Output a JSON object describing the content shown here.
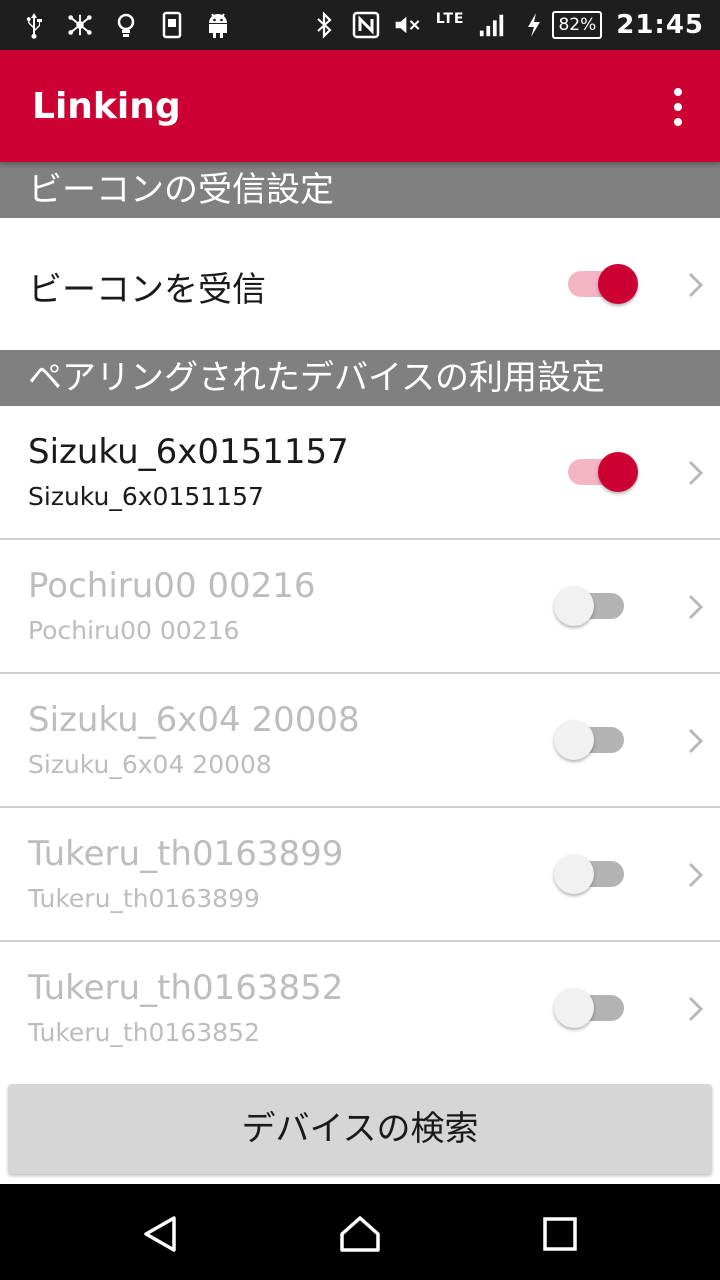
{
  "status_bar": {
    "left_icons": [
      "usb-icon",
      "network-sharing-icon",
      "lightbulb-icon",
      "phone-notification-icon",
      "android-icon"
    ],
    "right_icons": [
      "bluetooth-icon",
      "nfc-icon",
      "mute-icon",
      "signal-icon",
      "charging-icon"
    ],
    "network": "LTE",
    "battery": "82%",
    "time": "21:45"
  },
  "app_bar": {
    "title": "Linking",
    "menu_icon": "overflow-menu-icon",
    "color": "#cc0033"
  },
  "beacon_section": {
    "header": "ビーコンの受信設定",
    "row": {
      "title": "ビーコンを受信",
      "enabled": true
    }
  },
  "paired_section": {
    "header": "ペアリングされたデバイスの利用設定",
    "devices": [
      {
        "name": "Sizuku_6x0151157",
        "id": "Sizuku_6x0151157",
        "enabled": true
      },
      {
        "name": "Pochiru00 00216",
        "id": "Pochiru00 00216",
        "enabled": false
      },
      {
        "name": "Sizuku_6x04 20008",
        "id": "Sizuku_6x04 20008",
        "enabled": false
      },
      {
        "name": "Tukeru_th0163899",
        "id": "Tukeru_th0163899",
        "enabled": false
      },
      {
        "name": "Tukeru_th0163852",
        "id": "Tukeru_th0163852",
        "enabled": false
      }
    ]
  },
  "search_button": {
    "label": "デバイスの検索"
  },
  "nav_bar": {
    "back": "back-icon",
    "home": "home-icon",
    "recents": "recents-icon"
  },
  "colors": {
    "accent": "#cc0033",
    "section_header": "#808080",
    "disabled_text": "#bdbdbd"
  }
}
